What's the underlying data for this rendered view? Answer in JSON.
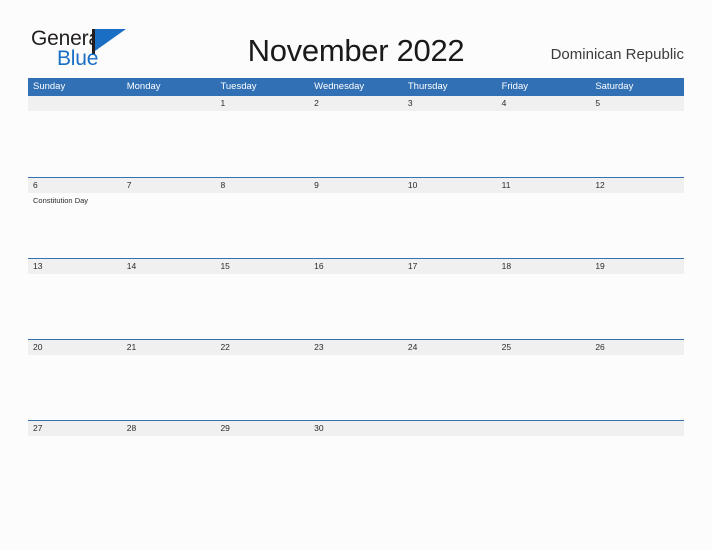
{
  "brand": {
    "name_part1": "General",
    "name_part2": "Blue",
    "logo_icon": "flag-triangle-icon",
    "color_dark": "#231f20",
    "color_blue": "#1a6fc4"
  },
  "header": {
    "title": "November 2022",
    "locale": "Dominican Republic"
  },
  "colors": {
    "header_bar": "#3170b4",
    "row_divider": "#3672b0",
    "day_band": "#f0f0f0",
    "page_background": "#fcfcfc",
    "text": "#2b2b2b"
  },
  "calendar": {
    "month": "November",
    "year": "2022",
    "weekdays": [
      "Sunday",
      "Monday",
      "Tuesday",
      "Wednesday",
      "Thursday",
      "Friday",
      "Saturday"
    ],
    "weeks": [
      {
        "days": [
          {
            "number": "",
            "events": []
          },
          {
            "number": "",
            "events": []
          },
          {
            "number": "1",
            "events": []
          },
          {
            "number": "2",
            "events": []
          },
          {
            "number": "3",
            "events": []
          },
          {
            "number": "4",
            "events": []
          },
          {
            "number": "5",
            "events": []
          }
        ]
      },
      {
        "days": [
          {
            "number": "6",
            "events": [
              "Constitution Day"
            ]
          },
          {
            "number": "7",
            "events": []
          },
          {
            "number": "8",
            "events": []
          },
          {
            "number": "9",
            "events": []
          },
          {
            "number": "10",
            "events": []
          },
          {
            "number": "11",
            "events": []
          },
          {
            "number": "12",
            "events": []
          }
        ]
      },
      {
        "days": [
          {
            "number": "13",
            "events": []
          },
          {
            "number": "14",
            "events": []
          },
          {
            "number": "15",
            "events": []
          },
          {
            "number": "16",
            "events": []
          },
          {
            "number": "17",
            "events": []
          },
          {
            "number": "18",
            "events": []
          },
          {
            "number": "19",
            "events": []
          }
        ]
      },
      {
        "days": [
          {
            "number": "20",
            "events": []
          },
          {
            "number": "21",
            "events": []
          },
          {
            "number": "22",
            "events": []
          },
          {
            "number": "23",
            "events": []
          },
          {
            "number": "24",
            "events": []
          },
          {
            "number": "25",
            "events": []
          },
          {
            "number": "26",
            "events": []
          }
        ]
      },
      {
        "days": [
          {
            "number": "27",
            "events": []
          },
          {
            "number": "28",
            "events": []
          },
          {
            "number": "29",
            "events": []
          },
          {
            "number": "30",
            "events": []
          },
          {
            "number": "",
            "events": []
          },
          {
            "number": "",
            "events": []
          },
          {
            "number": "",
            "events": []
          }
        ]
      }
    ]
  }
}
